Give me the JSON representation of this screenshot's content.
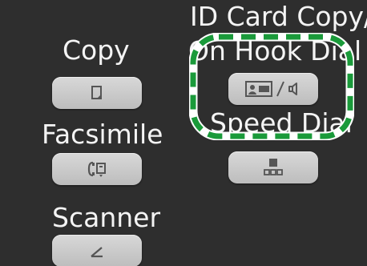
{
  "panel": {
    "copy": {
      "label": "Copy",
      "icon": "copy-icon"
    },
    "facsimile": {
      "label": "Facsimile",
      "icon": "fax-icon"
    },
    "scanner": {
      "label": "Scanner",
      "icon": "scanner-icon"
    },
    "id_card_copy": {
      "label_line1": "ID Card Copy/",
      "label_line2": "On Hook Dial",
      "icons": [
        "id-card-icon",
        "speaker-icon"
      ]
    },
    "speed_dial": {
      "label": "Speed Dial",
      "icon": "speed-dial-icon"
    }
  },
  "colors": {
    "background": "#2e2e2e",
    "key": "#c8c8c8",
    "icon": "#555555",
    "highlight": "#1a9a3a"
  }
}
